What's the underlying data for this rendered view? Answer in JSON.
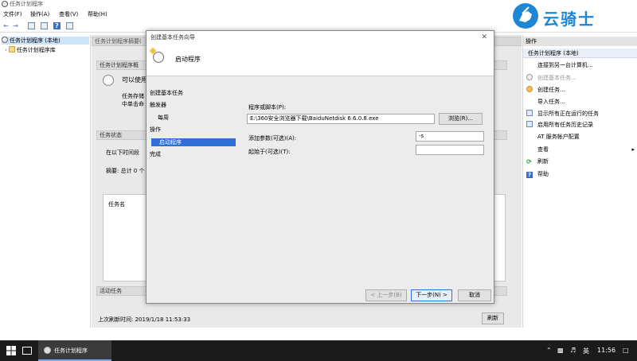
{
  "window": {
    "title": "任务计划程序"
  },
  "menu": [
    "文件(F)",
    "操作(A)",
    "查看(V)",
    "帮助(H)"
  ],
  "tree": {
    "root": "任务计划程序 (本地)",
    "child": "任务计划程序库"
  },
  "center": {
    "summary_header": "任务计划程序摘要(",
    "overview_head": "任务计划程序概",
    "can_use": "可以使用",
    "desc1": "任务存储",
    "desc2": "中单击命",
    "status_head": "任务状态",
    "status_period": "在以下时间段",
    "summary_count": "摘要: 总计 0 个",
    "task_name_col": "任务名",
    "active_tasks_head": "活动任务",
    "last_refresh": "上次刷新时间: 2019/1/18 11:53:33",
    "refresh_button": "刷新"
  },
  "dialog": {
    "title": "创建基本任务向导",
    "header": "启动程序",
    "steps": [
      "创建基本任务",
      "触发器",
      "每周",
      "操作",
      "启动程序",
      "完成"
    ],
    "active_step_index": 4,
    "program_label": "程序或脚本(P):",
    "program_value": "E:\\360安全浏览器下载\\BaiduNetdisk 6.6.0.8.exe",
    "browse_button": "浏览(R)...",
    "args_label": "添加参数(可选)(A):",
    "args_value": "-s",
    "startin_label": "起始于(可选)(T):",
    "startin_value": "",
    "back_button": "< 上一步(B)",
    "next_button": "下一步(N) >",
    "cancel_button": "取消"
  },
  "actions": {
    "header": "操作",
    "subheader": "任务计划程序 (本地)",
    "items": [
      "连接到另一台计算机...",
      "创建基本任务...",
      "创建任务...",
      "导入任务...",
      "显示所有正在运行的任务",
      "启用所有任务历史记录",
      "AT 服务帐户配置",
      "查看",
      "刷新",
      "帮助"
    ]
  },
  "taskbar": {
    "app_label": "任务计划程序",
    "ime": "英",
    "clock": "11:56"
  },
  "watermark": {
    "text": "云骑士"
  },
  "colors": {
    "accent": "#2f6fd6",
    "watermark": "#1e86d4",
    "taskbar": "#1b1b1b"
  }
}
